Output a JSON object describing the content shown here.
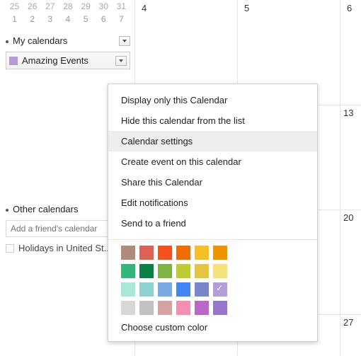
{
  "mini_cal": {
    "row1": [
      "25",
      "26",
      "27",
      "28",
      "29",
      "30",
      "31"
    ],
    "row2": [
      "1",
      "2",
      "3",
      "4",
      "5",
      "6",
      "7"
    ]
  },
  "sections": {
    "my_calendars": "My calendars",
    "other_calendars": "Other calendars"
  },
  "calendar_item": {
    "name": "Amazing Events",
    "color": "#b19cd9"
  },
  "add_friend_placeholder": "Add a friend's calendar",
  "holiday_label": "Holidays in United St..",
  "day_numbers": {
    "d4": "4",
    "d5": "5",
    "d6": "6",
    "d13": "13",
    "d20": "20",
    "d27": "27"
  },
  "menu": {
    "items": [
      "Display only this Calendar",
      "Hide this calendar from the list",
      "Calendar settings",
      "Create event on this calendar",
      "Share this Calendar",
      "Edit notifications",
      "Send to a friend"
    ],
    "highlighted_index": 2,
    "colors": [
      "#b08b7d",
      "#e06055",
      "#f4511e",
      "#ef6c00",
      "#f6bf26",
      "#f09300",
      "#33b679",
      "#0b8043",
      "#7cb342",
      "#c0ca33",
      "#e4c441",
      "#f6e07a",
      "#a7e8d6",
      "#8ed1d1",
      "#7ba9e6",
      "#4285f4",
      "#7986cb",
      "#b39ddb",
      "#d7d7d7",
      "#c2c2c2",
      "#d6a1a1",
      "#f48fb1",
      "#ba68c8",
      "#9575cd"
    ],
    "selected_color_index": 17,
    "custom_label": "Choose custom color"
  }
}
